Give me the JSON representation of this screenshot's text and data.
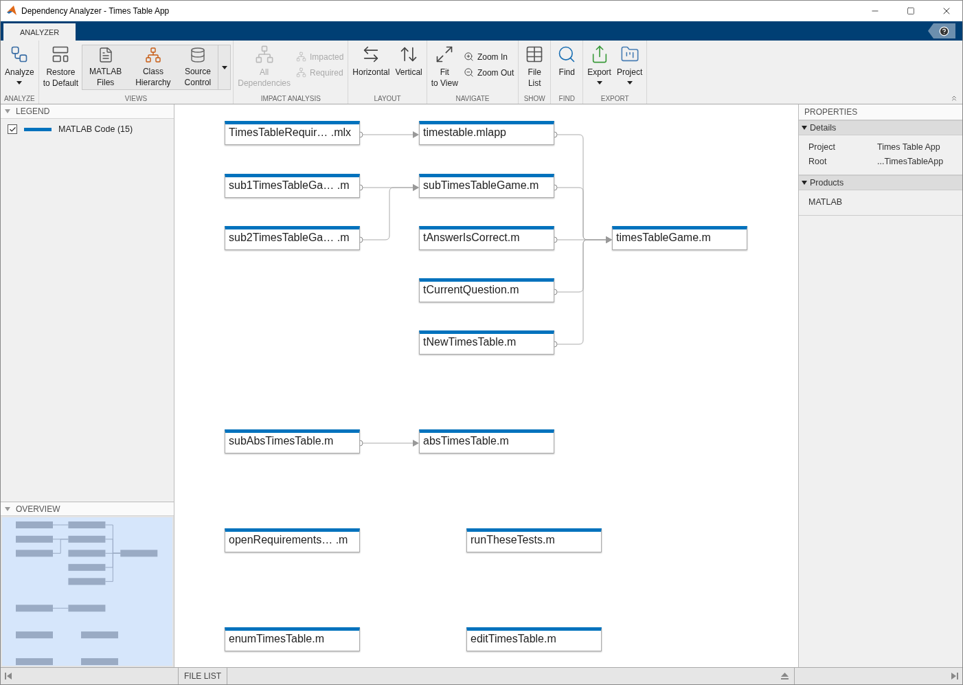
{
  "window": {
    "title": "Dependency Analyzer - Times Table App"
  },
  "ribbon": {
    "tabs": [
      {
        "label": "ANALYZER",
        "selected": true
      }
    ],
    "groups": [
      {
        "label": "ANALYZE",
        "items": [
          {
            "kind": "large",
            "lines": [
              "Analyze"
            ],
            "dropdown": true,
            "disabled": false
          }
        ]
      },
      {
        "label": "VIEWS",
        "items": [
          {
            "kind": "large",
            "lines": [
              "Restore",
              "to Default"
            ],
            "dropdown": false,
            "disabled": false
          },
          {
            "kind": "gallery",
            "items": [
              {
                "lines": [
                  "MATLAB",
                  "Files"
                ]
              },
              {
                "lines": [
                  "Class",
                  "Hierarchy"
                ]
              },
              {
                "lines": [
                  "Source",
                  "Control"
                ]
              }
            ]
          }
        ]
      },
      {
        "label": "IMPACT ANALYSIS",
        "items": [
          {
            "kind": "large",
            "lines": [
              "All",
              "Dependencies"
            ],
            "dropdown": false,
            "disabled": true
          },
          {
            "kind": "small",
            "lines": [
              "Impacted"
            ],
            "disabled": true
          },
          {
            "kind": "small",
            "lines": [
              "Required"
            ],
            "disabled": true
          }
        ]
      },
      {
        "label": "LAYOUT",
        "items": [
          {
            "kind": "large",
            "lines": [
              "Horizontal"
            ],
            "dropdown": false,
            "disabled": false
          },
          {
            "kind": "large",
            "lines": [
              "Vertical"
            ],
            "dropdown": false,
            "disabled": false
          }
        ]
      },
      {
        "label": "NAVIGATE",
        "items": [
          {
            "kind": "large",
            "lines": [
              "Fit",
              "to View"
            ],
            "dropdown": false,
            "disabled": false
          },
          {
            "kind": "small",
            "lines": [
              "Zoom In"
            ],
            "disabled": false
          },
          {
            "kind": "small",
            "lines": [
              "Zoom Out"
            ],
            "disabled": false
          }
        ]
      },
      {
        "label": "SHOW",
        "items": [
          {
            "kind": "large",
            "lines": [
              "File",
              "List"
            ],
            "dropdown": false,
            "disabled": false
          }
        ]
      },
      {
        "label": "FIND",
        "items": [
          {
            "kind": "large",
            "lines": [
              "Find"
            ],
            "dropdown": false,
            "disabled": false
          }
        ]
      },
      {
        "label": "EXPORT",
        "items": [
          {
            "kind": "large",
            "lines": [
              "Export"
            ],
            "dropdown": true,
            "disabled": false
          },
          {
            "kind": "large",
            "lines": [
              "Project"
            ],
            "dropdown": true,
            "disabled": false
          }
        ]
      }
    ]
  },
  "legend": {
    "title": "LEGEND",
    "expanded": true,
    "items": [
      {
        "label": "MATLAB Code (15)",
        "checked": true,
        "color": "#0072bd"
      }
    ]
  },
  "overview": {
    "title": "OVERVIEW",
    "expanded": true
  },
  "graph": {
    "nodes": [
      {
        "label": "TimesTableRequir… .mlx"
      },
      {
        "label": "timestable.mlapp"
      },
      {
        "label": "sub1TimesTableGa… .m"
      },
      {
        "label": "subTimesTableGame.m"
      },
      {
        "label": "sub2TimesTableGa… .m"
      },
      {
        "label": "tAnswerIsCorrect.m"
      },
      {
        "label": "timesTableGame.m"
      },
      {
        "label": "tCurrentQuestion.m"
      },
      {
        "label": "tNewTimesTable.m"
      },
      {
        "label": "subAbsTimesTable.m"
      },
      {
        "label": "absTimesTable.m"
      },
      {
        "label": "openRequirements… .m"
      },
      {
        "label": "runTheseTests.m"
      },
      {
        "label": "enumTimesTable.m"
      },
      {
        "label": "editTimesTable.m"
      }
    ]
  },
  "properties": {
    "title": "PROPERTIES",
    "sections": [
      {
        "title": "Details",
        "expanded": true,
        "rows": [
          {
            "label": "Project",
            "value": "Times Table App"
          },
          {
            "label": "Root",
            "value": "...TimesTableApp"
          }
        ]
      },
      {
        "title": "Products",
        "expanded": true,
        "rows": [
          {
            "label": "MATLAB"
          }
        ]
      }
    ]
  },
  "bottom_tabs": [
    {
      "label": "FILE LIST",
      "selected": false
    }
  ]
}
